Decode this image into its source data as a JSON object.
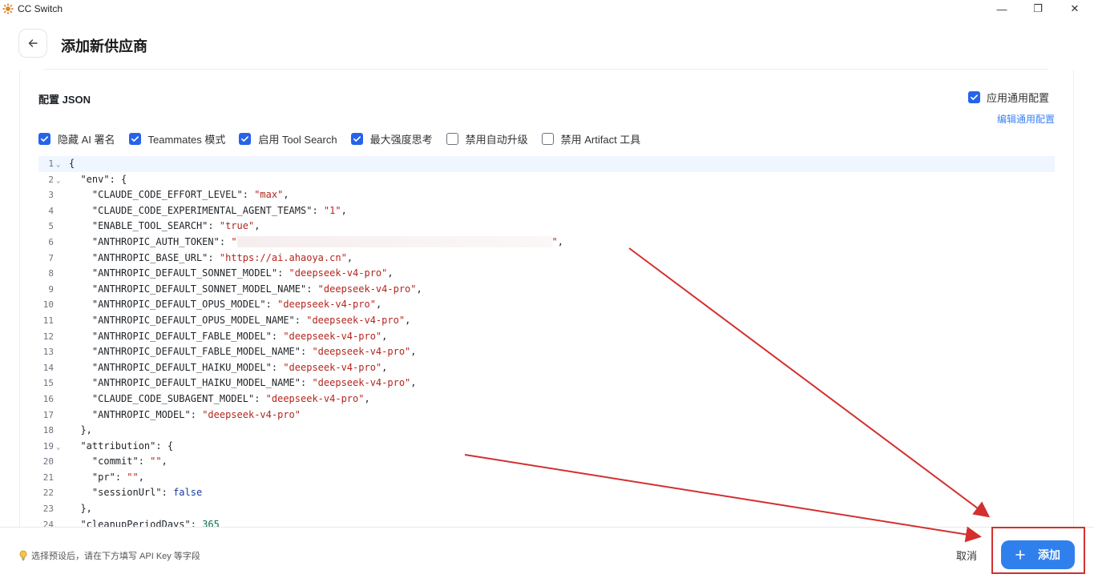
{
  "window": {
    "title": "CC Switch",
    "minimize_glyph": "—",
    "maximize_glyph": "❐",
    "close_glyph": "✕"
  },
  "header": {
    "title": "添加新供应商",
    "back_icon": "arrow-left-icon"
  },
  "config": {
    "label": "配置 JSON",
    "apply_common_label": "应用通用配置",
    "apply_common_checked": true,
    "edit_common_link": "编辑通用配置",
    "options": [
      {
        "label": "隐藏 AI 署名",
        "checked": true
      },
      {
        "label": "Teammates 模式",
        "checked": true
      },
      {
        "label": "启用 Tool Search",
        "checked": true
      },
      {
        "label": "最大强度思考",
        "checked": true
      },
      {
        "label": "禁用自动升级",
        "checked": false
      },
      {
        "label": "禁用 Artifact 工具",
        "checked": false
      }
    ]
  },
  "editor": {
    "lines": [
      {
        "n": "1",
        "fold": true,
        "indent": 0,
        "key": "",
        "raw": "{"
      },
      {
        "n": "2",
        "fold": true,
        "indent": 1,
        "key": "\"env\"",
        "raw": ": {"
      },
      {
        "n": "3",
        "indent": 2,
        "key": "\"CLAUDE_CODE_EFFORT_LEVEL\"",
        "val": "\"max\"",
        "vt": "s",
        "tail": ","
      },
      {
        "n": "4",
        "indent": 2,
        "key": "\"CLAUDE_CODE_EXPERIMENTAL_AGENT_TEAMS\"",
        "val": "\"1\"",
        "vt": "s",
        "tail": ","
      },
      {
        "n": "5",
        "indent": 2,
        "key": "\"ENABLE_TOOL_SEARCH\"",
        "val": "\"true\"",
        "vt": "s",
        "tail": ","
      },
      {
        "n": "6",
        "indent": 2,
        "key": "\"ANTHROPIC_AUTH_TOKEN\"",
        "val": "\"",
        "vt": "s",
        "masked": true,
        "val2": "\"",
        "tail": ","
      },
      {
        "n": "7",
        "indent": 2,
        "key": "\"ANTHROPIC_BASE_URL\"",
        "val": "\"https://ai.ahaoya.cn\"",
        "vt": "s",
        "tail": ","
      },
      {
        "n": "8",
        "indent": 2,
        "key": "\"ANTHROPIC_DEFAULT_SONNET_MODEL\"",
        "val": "\"deepseek-v4-pro\"",
        "vt": "s",
        "tail": ","
      },
      {
        "n": "9",
        "indent": 2,
        "key": "\"ANTHROPIC_DEFAULT_SONNET_MODEL_NAME\"",
        "val": "\"deepseek-v4-pro\"",
        "vt": "s",
        "tail": ","
      },
      {
        "n": "10",
        "indent": 2,
        "key": "\"ANTHROPIC_DEFAULT_OPUS_MODEL\"",
        "val": "\"deepseek-v4-pro\"",
        "vt": "s",
        "tail": ","
      },
      {
        "n": "11",
        "indent": 2,
        "key": "\"ANTHROPIC_DEFAULT_OPUS_MODEL_NAME\"",
        "val": "\"deepseek-v4-pro\"",
        "vt": "s",
        "tail": ","
      },
      {
        "n": "12",
        "indent": 2,
        "key": "\"ANTHROPIC_DEFAULT_FABLE_MODEL\"",
        "val": "\"deepseek-v4-pro\"",
        "vt": "s",
        "tail": ","
      },
      {
        "n": "13",
        "indent": 2,
        "key": "\"ANTHROPIC_DEFAULT_FABLE_MODEL_NAME\"",
        "val": "\"deepseek-v4-pro\"",
        "vt": "s",
        "tail": ","
      },
      {
        "n": "14",
        "indent": 2,
        "key": "\"ANTHROPIC_DEFAULT_HAIKU_MODEL\"",
        "val": "\"deepseek-v4-pro\"",
        "vt": "s",
        "tail": ","
      },
      {
        "n": "15",
        "indent": 2,
        "key": "\"ANTHROPIC_DEFAULT_HAIKU_MODEL_NAME\"",
        "val": "\"deepseek-v4-pro\"",
        "vt": "s",
        "tail": ","
      },
      {
        "n": "16",
        "indent": 2,
        "key": "\"CLAUDE_CODE_SUBAGENT_MODEL\"",
        "val": "\"deepseek-v4-pro\"",
        "vt": "s",
        "tail": ","
      },
      {
        "n": "17",
        "indent": 2,
        "key": "\"ANTHROPIC_MODEL\"",
        "val": "\"deepseek-v4-pro\"",
        "vt": "s",
        "tail": ""
      },
      {
        "n": "18",
        "indent": 1,
        "key": "",
        "raw": "},"
      },
      {
        "n": "19",
        "fold": true,
        "indent": 1,
        "key": "\"attribution\"",
        "raw": ": {"
      },
      {
        "n": "20",
        "indent": 2,
        "key": "\"commit\"",
        "val": "\"\"",
        "vt": "s",
        "tail": ","
      },
      {
        "n": "21",
        "indent": 2,
        "key": "\"pr\"",
        "val": "\"\"",
        "vt": "s",
        "tail": ","
      },
      {
        "n": "22",
        "indent": 2,
        "key": "\"sessionUrl\"",
        "val": "false",
        "vt": "b",
        "tail": ""
      },
      {
        "n": "23",
        "indent": 1,
        "key": "",
        "raw": "},"
      },
      {
        "n": "24",
        "indent": 1,
        "key": "\"cleanupPeriodDays\"",
        "val": "365",
        "vt": "n",
        "tail": ""
      }
    ]
  },
  "footer": {
    "hint_icon": "lightbulb-icon",
    "hint": "选择预设后，请在下方填写 API Key 等字段",
    "cancel_label": "取消",
    "add_label": "添加",
    "add_icon": "plus-icon"
  },
  "colors": {
    "accent": "#2f80ed",
    "checkbox": "#2563eb",
    "annotation": "#d32f2f",
    "string": "#b3261e"
  }
}
